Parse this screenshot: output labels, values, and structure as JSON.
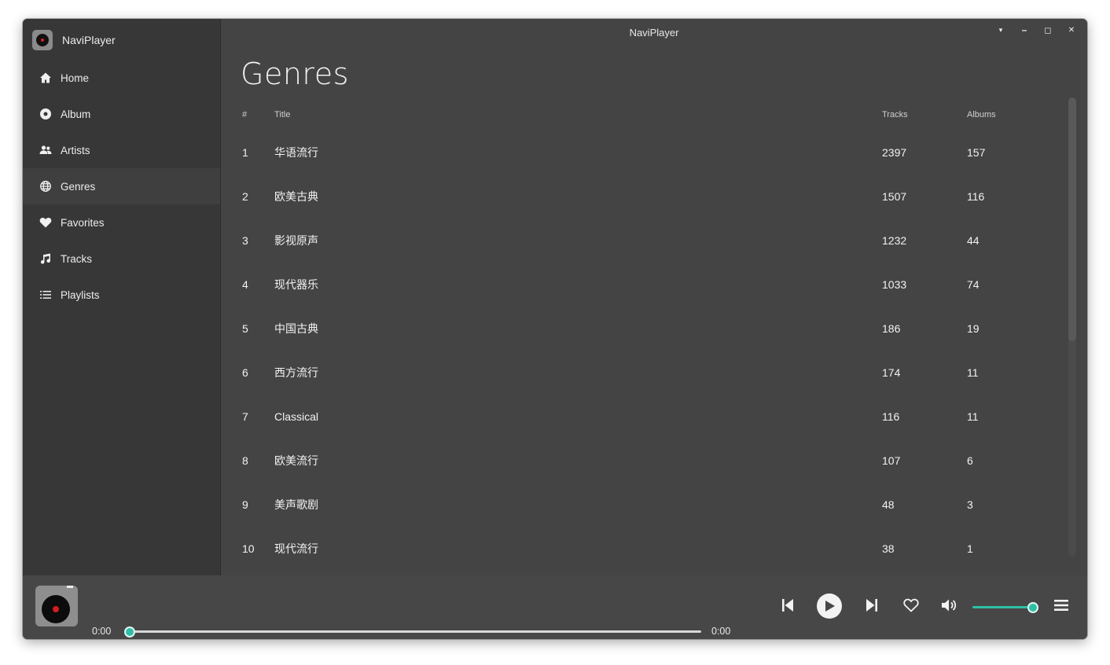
{
  "app": {
    "title": "NaviPlayer",
    "brand": "NaviPlayer"
  },
  "window_controls": {
    "dropdown": "▾",
    "minimize": "–",
    "maximize": "◻",
    "close": "✕"
  },
  "sidebar": {
    "items": [
      {
        "label": "Home",
        "icon": "home-icon"
      },
      {
        "label": "Album",
        "icon": "album-icon"
      },
      {
        "label": "Artists",
        "icon": "artists-icon"
      },
      {
        "label": "Genres",
        "icon": "globe-icon",
        "active": true
      },
      {
        "label": "Favorites",
        "icon": "heart-icon"
      },
      {
        "label": "Tracks",
        "icon": "music-note-icon"
      },
      {
        "label": "Playlists",
        "icon": "list-icon"
      }
    ]
  },
  "page": {
    "title": "Genres"
  },
  "table": {
    "headers": {
      "num": "#",
      "title": "Title",
      "tracks": "Tracks",
      "albums": "Albums"
    },
    "rows": [
      {
        "num": "1",
        "title": "华语流行",
        "tracks": "2397",
        "albums": "157"
      },
      {
        "num": "2",
        "title": "欧美古典",
        "tracks": "1507",
        "albums": "116"
      },
      {
        "num": "3",
        "title": "影视原声",
        "tracks": "1232",
        "albums": "44"
      },
      {
        "num": "4",
        "title": "现代器乐",
        "tracks": "1033",
        "albums": "74"
      },
      {
        "num": "5",
        "title": "中国古典",
        "tracks": "186",
        "albums": "19"
      },
      {
        "num": "6",
        "title": "西方流行",
        "tracks": "174",
        "albums": "11"
      },
      {
        "num": "7",
        "title": "Classical",
        "tracks": "116",
        "albums": "11"
      },
      {
        "num": "8",
        "title": "欧美流行",
        "tracks": "107",
        "albums": "6"
      },
      {
        "num": "9",
        "title": "美声歌剧",
        "tracks": "48",
        "albums": "3"
      },
      {
        "num": "10",
        "title": "现代流行",
        "tracks": "38",
        "albums": "1"
      }
    ]
  },
  "player": {
    "elapsed": "0:00",
    "duration": "0:00",
    "progress": 0,
    "volume": 1.0,
    "accent_color": "#2fbfa6"
  }
}
